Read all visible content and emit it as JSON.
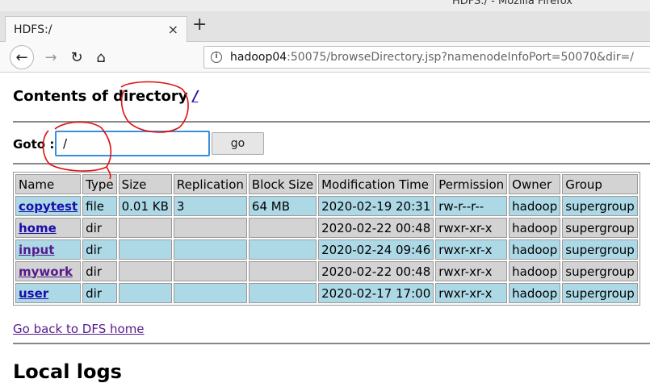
{
  "window": {
    "title": "HDFS:/ - Mozilla Firefox"
  },
  "tab": {
    "title": "HDFS:/",
    "close_glyph": "×",
    "new_tab_glyph": "+"
  },
  "nav": {
    "back_glyph": "←",
    "forward_glyph": "→",
    "reload_glyph": "↻",
    "home_glyph": "⌂",
    "url_host": "hadoop04",
    "url_rest": ":50075/browseDirectory.jsp?namenodeInfoPort=50070&dir=/"
  },
  "page": {
    "heading_prefix": "Contents of directory ",
    "heading_link": "/",
    "goto_label": "Goto :",
    "goto_value": "/",
    "go_button": "go",
    "back_link": "Go back to DFS home",
    "local_logs_heading": "Local logs"
  },
  "table": {
    "headers": [
      "Name",
      "Type",
      "Size",
      "Replication",
      "Block Size",
      "Modification Time",
      "Permission",
      "Owner",
      "Group"
    ],
    "rows": [
      {
        "name": "copytest",
        "type": "file",
        "size": "0.01 KB",
        "replication": "3",
        "block_size": "64 MB",
        "mtime": "2020-02-19 20:31",
        "permission": "rw-r--r--",
        "owner": "hadoop",
        "group": "supergroup"
      },
      {
        "name": "home",
        "type": "dir",
        "size": "",
        "replication": "",
        "block_size": "",
        "mtime": "2020-02-22 00:48",
        "permission": "rwxr-xr-x",
        "owner": "hadoop",
        "group": "supergroup"
      },
      {
        "name": "input",
        "type": "dir",
        "size": "",
        "replication": "",
        "block_size": "",
        "mtime": "2020-02-24 09:46",
        "permission": "rwxr-xr-x",
        "owner": "hadoop",
        "group": "supergroup"
      },
      {
        "name": "mywork",
        "type": "dir",
        "size": "",
        "replication": "",
        "block_size": "",
        "mtime": "2020-02-22 00:48",
        "permission": "rwxr-xr-x",
        "owner": "hadoop",
        "group": "supergroup"
      },
      {
        "name": "user",
        "type": "dir",
        "size": "",
        "replication": "",
        "block_size": "",
        "mtime": "2020-02-17 17:00",
        "permission": "rwxr-xr-x",
        "owner": "hadoop",
        "group": "supergroup"
      }
    ]
  },
  "colors": {
    "row_blue": "#add8e6",
    "row_gray": "#d3d3d3",
    "annotation_red": "#e01010",
    "link_blue": "#1a0dab",
    "link_visited": "#551a8b"
  }
}
